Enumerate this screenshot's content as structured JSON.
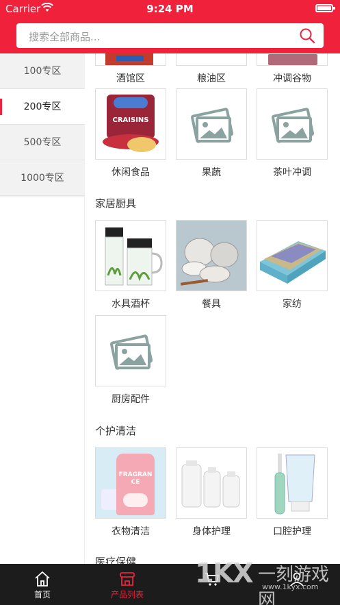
{
  "status_bar": {
    "carrier": "Carrier",
    "time": "9:24 PM"
  },
  "search": {
    "placeholder": "搜索全部商品..."
  },
  "sidebar": {
    "items": [
      {
        "label": "100专区"
      },
      {
        "label": "200专区"
      },
      {
        "label": "500专区"
      },
      {
        "label": "1000专区"
      }
    ],
    "active_index": 1
  },
  "sections": [
    {
      "title": "",
      "items": [
        {
          "label": "酒馆区",
          "image": "liquor-photo"
        },
        {
          "label": "粮油区",
          "image": "grain-oil-photo"
        },
        {
          "label": "冲调谷物",
          "image": "cereal-photo"
        },
        {
          "label": "休闲食品",
          "image": "craisins-snack-photo",
          "photo_text": "CRAISINS"
        },
        {
          "label": "果蔬",
          "image": "placeholder-image-icon"
        },
        {
          "label": "茶叶冲调",
          "image": "placeholder-image-icon"
        }
      ]
    },
    {
      "title": "家居厨具",
      "items": [
        {
          "label": "水具酒杯",
          "image": "glass-tumbler-photo"
        },
        {
          "label": "餐具",
          "image": "tableware-photo"
        },
        {
          "label": "家纺",
          "image": "bedding-photo"
        },
        {
          "label": "厨房配件",
          "image": "placeholder-image-icon"
        }
      ]
    },
    {
      "title": "个护清洁",
      "items": [
        {
          "label": "衣物清洁",
          "image": "laundry-detergent-photo",
          "photo_text": "FRAGRANCE"
        },
        {
          "label": "身体护理",
          "image": "body-care-bottles-photo"
        },
        {
          "label": "口腔护理",
          "image": "toothbrush-toothpaste-photo"
        }
      ]
    },
    {
      "title": "医疗保健",
      "items": []
    }
  ],
  "tabbar": {
    "items": [
      {
        "label": "首页",
        "icon": "home-icon"
      },
      {
        "label": "产品列表",
        "icon": "store-icon"
      },
      {
        "label": "",
        "icon": "cart-icon"
      },
      {
        "label": "",
        "icon": "user-icon"
      }
    ],
    "active_index": 1
  },
  "watermark": {
    "logo": "1KX",
    "name": "一刻游戏网",
    "url": "www.1kyx.com"
  },
  "colors": {
    "brand_red": "#f0213b",
    "tabbar_bg": "#1c1c1c",
    "sidebar_bg": "#f2f2f2"
  }
}
